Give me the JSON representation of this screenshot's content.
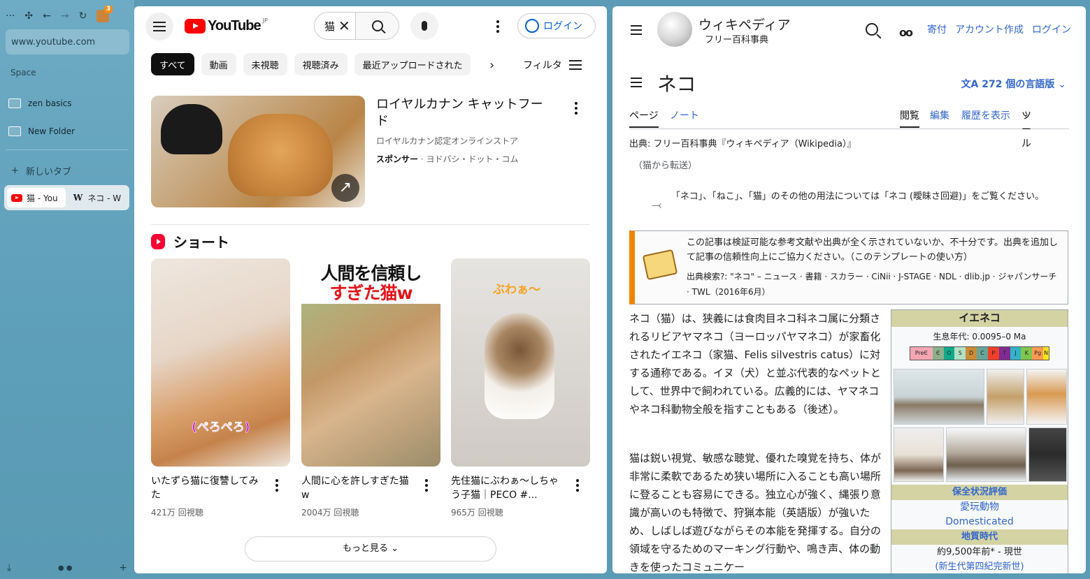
{
  "sidebar": {
    "toolbar": {
      "more": "···",
      "ext_badge": "3"
    },
    "url": "www.youtube.com",
    "space_label": "Space",
    "folders": [
      "zen basics",
      "New Folder"
    ],
    "new_tab": "新しいタブ",
    "tabs": [
      {
        "title": "猫 - You",
        "icon": "youtube-icon"
      },
      {
        "title": "ネコ - W",
        "icon": "wikipedia-icon"
      }
    ]
  },
  "youtube": {
    "logo_text": "YouTube",
    "logo_region": "JP",
    "search_value": "猫",
    "login_label": "ログイン",
    "chips": [
      "すべて",
      "動画",
      "未視聴",
      "視聴済み",
      "最近アップロードされた"
    ],
    "filter_label": "フィルタ",
    "ad": {
      "title": "ロイヤルカナン キャットフード",
      "channel": "ロイヤルカナン認定オンラインストア",
      "sponsor": "スポンサー",
      "sponsor_rest": " · ヨドバシ・ドット・コム"
    },
    "shorts_heading": "ショート",
    "shorts": [
      {
        "title": "いたずら猫に復讐してみた",
        "views": "421万 回視聴",
        "overlay": "(ぺろぺろ)"
      },
      {
        "title": "人間に心を許しすぎた猫w",
        "views": "2004万 回視聴",
        "overlay_top": "人間を信頼し",
        "overlay_bottom": "すぎた猫w"
      },
      {
        "title": "先住猫にぶわぁ～しちゃう子猫｜PECO #...",
        "views": "965万 回視聴",
        "overlay": "ぶわぁ～"
      }
    ],
    "more_label": "もっと見る"
  },
  "wikipedia": {
    "site_name": "ウィキペディア",
    "tagline": "フリー百科事典",
    "header_links": [
      "寄付",
      "アカウント作成",
      "ログイン"
    ],
    "title": "ネコ",
    "languages": "272 個の言語版",
    "tabs_left": [
      "ページ",
      "ノート"
    ],
    "tabs_right": [
      "閲覧",
      "編集",
      "履歴を表示",
      "ツール"
    ],
    "from": "出典: フリー百科事典『ウィキペディア（Wikipedia）』",
    "redirect": "（猫から転送）",
    "hatnote": "「ネコ」、「ねこ」、「猫」のその他の用法については「ネコ (曖昧さ回避)」をご覧ください。",
    "ambox_text": "この記事は検証可能な参考文献や出典が全く示されていないか、不十分です。出典を追加して記事の信頼性向上にご協力ください。（このテンプレートの使い方）",
    "ambox_sources": "出典検索?: \"ネコ\" – ニュース · 書籍 · スカラー · CiNii · J-STAGE · NDL · dlib.jp · ジャパンサーチ · TWL（2016年6月）",
    "para1": "ネコ（猫）は、狭義には食肉目ネコ科ネコ属に分類されるリビアヤマネコ（ヨーロッパヤマネコ）が家畜化されたイエネコ（家猫、Felis silvestris catus）に対する通称である。イヌ（犬）と並ぶ代表的なペットとして、世界中で飼われている。広義的には、ヤマネコやネコ科動物全般を指すこともある（後述）。",
    "para2": "猫は鋭い視覚、敏感な聴覚、優れた嗅覚を持ち、体が非常に柔軟であるため狭い場所に入ることも高い場所に登ることも容易にできる。独立心が強く、縄張り意識が高いのも特徴で、狩猟本能（英語版）が強いため、しばしば遊びながらその本能を発揮する。自分の領域を守るためのマーキング行動や、鳴き声、体の動きを使ったコミュニケー",
    "infobox": {
      "title": "イエネコ",
      "range": "生息年代: 0.0095–0 Ma",
      "geo": [
        "PreЄ",
        "Є",
        "O",
        "S",
        "D",
        "C",
        "P",
        "T",
        "J",
        "K",
        "Pg",
        "N"
      ],
      "conservation_heading": "保全状況評価",
      "conservation": [
        "愛玩動物",
        "Domesticated"
      ],
      "geologic_heading": "地質時代",
      "geologic": "約9,500年前* - 現世",
      "geologic2": "(新生代第四紀完新世)"
    }
  },
  "colors": {
    "youtube_red": "#ff0000",
    "wiki_link": "#3366cc",
    "ambox_bar": "#f28500"
  }
}
